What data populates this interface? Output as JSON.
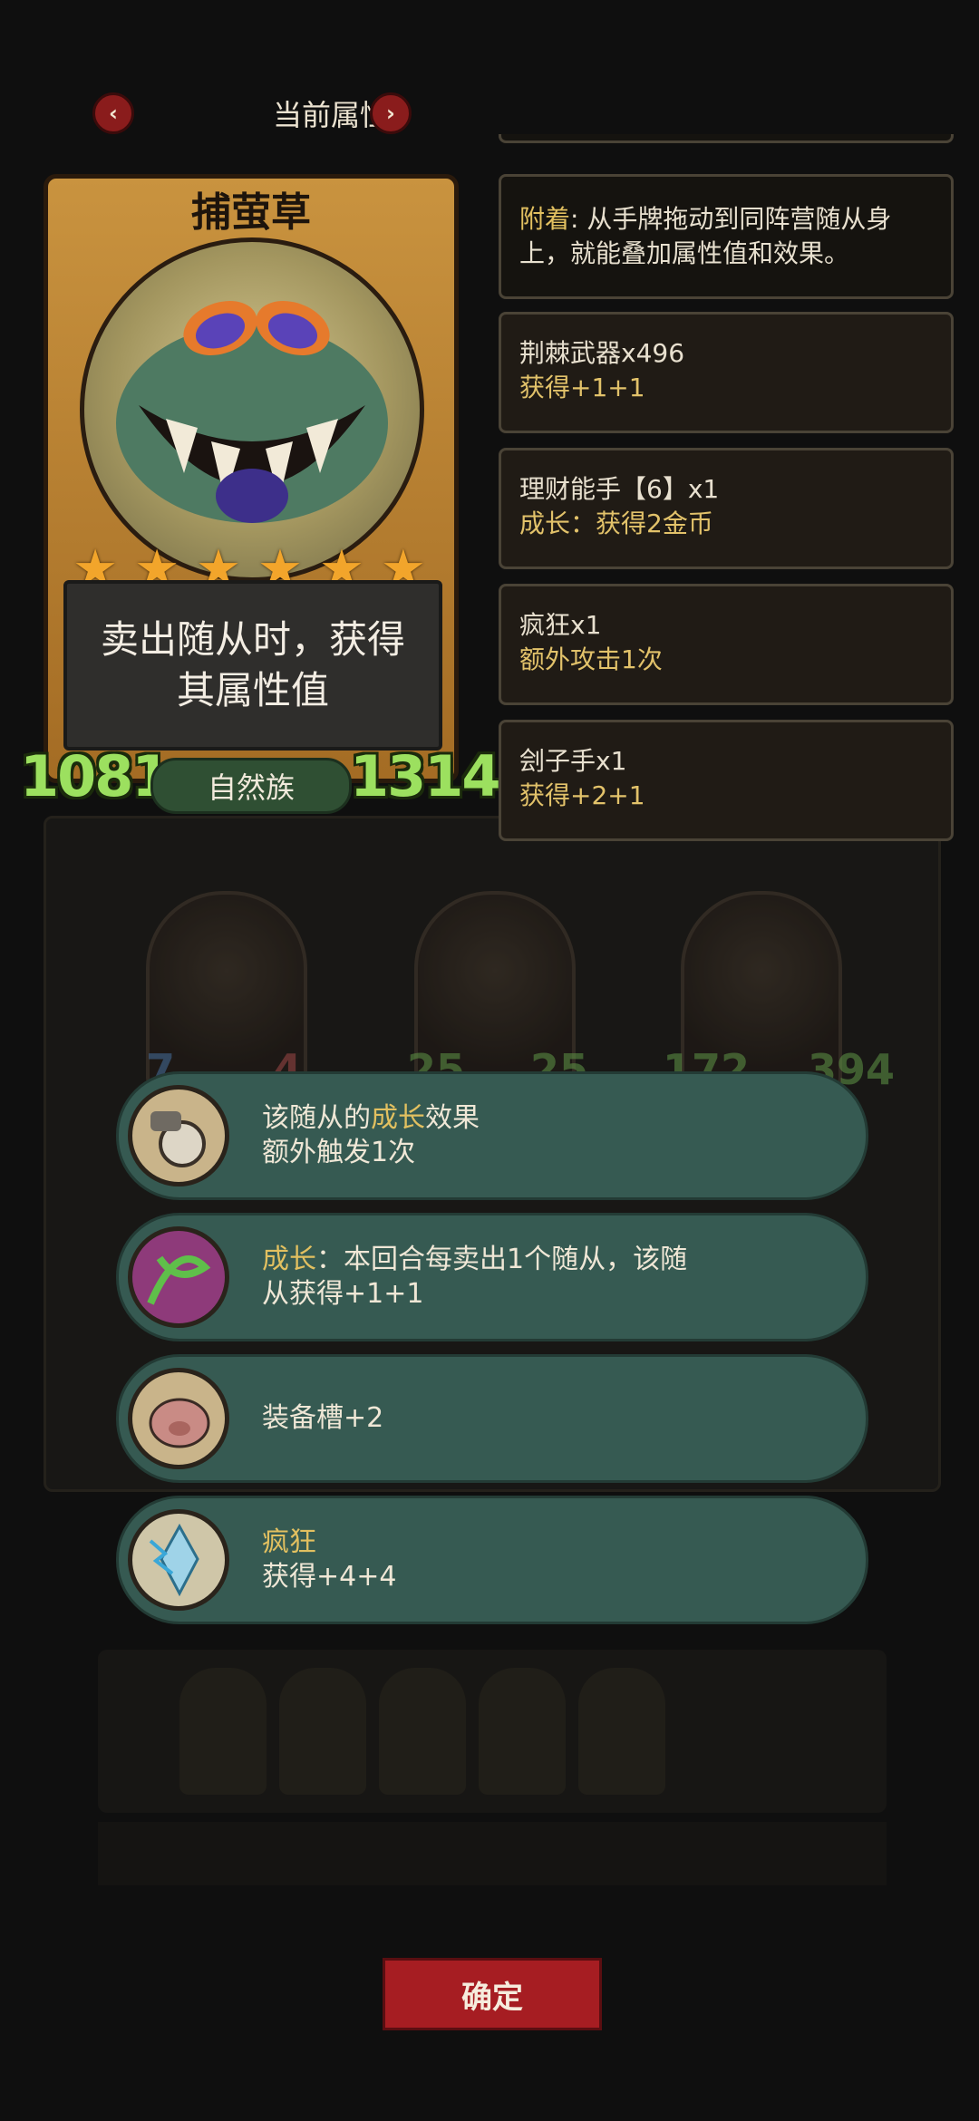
{
  "header": {
    "title": "当前属性",
    "prev_icon": "‹",
    "next_icon": "›"
  },
  "card": {
    "name": "捕萤草",
    "stars": [
      "★",
      "★",
      "★",
      "★",
      "★",
      "★"
    ],
    "description_lines": [
      "卖出随从时，获得",
      "其属性值"
    ],
    "attack": "1081",
    "health": "1314",
    "tribe": "自然族"
  },
  "info": {
    "attach": {
      "keyword": "附着",
      "text_1": ": 从手牌拖动到同阵营随从身",
      "text_2": "上，就能叠加属性值和效果。"
    },
    "buffs": [
      {
        "name": "荆棘武器x496",
        "detail": "获得+1+1"
      },
      {
        "name": "理财能手【6】x1",
        "detail": "成长：获得2金币"
      },
      {
        "name": "疯狂x1",
        "detail": "额外攻击1次"
      },
      {
        "name": "刽子手x1",
        "detail": "获得+2+1"
      }
    ]
  },
  "abilities": [
    {
      "line1_pre": "该随从的",
      "line1_hl": "成长",
      "line1_post": "效果",
      "line2": "额外触发1次"
    },
    {
      "line1_pre": "",
      "line1_hl": "成长",
      "line1_post": "：本回合每卖出1个随从，该随",
      "line2": "从获得+1+1"
    },
    {
      "line1_pre": "装备槽+2",
      "line1_hl": "",
      "line1_post": "",
      "line2": ""
    },
    {
      "line1_pre": "",
      "line1_hl": "疯狂",
      "line1_post": "",
      "line2": "获得+4+4"
    }
  ],
  "background_board": {
    "stats": [
      "7",
      "4",
      "25",
      "25",
      "172",
      "394"
    ]
  },
  "confirm_label": "确定",
  "colors": {
    "stat_green": "#9ce05f",
    "keyword_gold": "#e2c060",
    "ability_bg": "#365a52",
    "confirm_red": "#a61d22"
  }
}
